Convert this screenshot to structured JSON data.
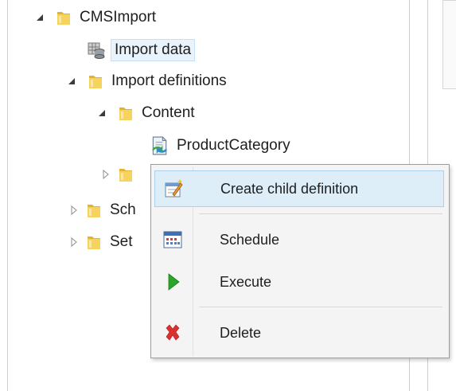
{
  "tree": {
    "cmsimport": "CMSImport",
    "import_data": "Import data",
    "import_definitions": "Import definitions",
    "content": "Content",
    "product_category": "ProductCategory",
    "sch_partial": "Sch",
    "set_partial": "Set"
  },
  "context_menu": {
    "create_child": "Create child definition",
    "schedule": "Schedule",
    "execute": "Execute",
    "delete": "Delete"
  },
  "icons": {
    "tree": [
      "folder-icon",
      "database-icon",
      "definition-icon",
      "triangle-expanded-icon",
      "triangle-collapsed-icon"
    ],
    "menu": [
      "create-definition-icon",
      "calendar-icon",
      "play-icon",
      "delete-x-icon"
    ]
  },
  "colors": {
    "selection_bg": "#e8f3fc",
    "menu_hover_bg": "#ddeef9",
    "execute_green": "#2aa52a",
    "delete_red": "#d9312f"
  }
}
